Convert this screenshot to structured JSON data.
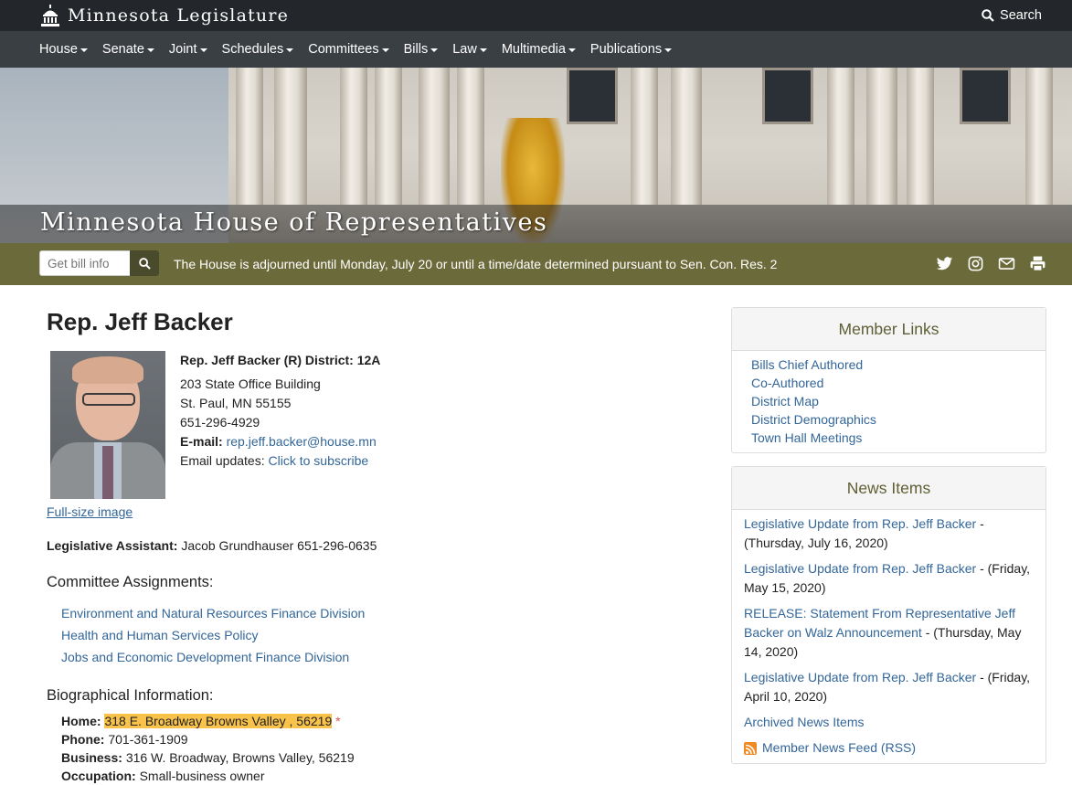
{
  "header": {
    "site_title": "Minnesota Legislature",
    "search_label": "Search"
  },
  "nav": {
    "items": [
      "House",
      "Senate",
      "Joint",
      "Schedules",
      "Committees",
      "Bills",
      "Law",
      "Multimedia",
      "Publications"
    ]
  },
  "hero": {
    "title": "Minnesota House of Representatives"
  },
  "olive_bar": {
    "bill_placeholder": "Get bill info",
    "notice": "The House is adjourned until Monday, July 20 or until a time/date determined pursuant to Sen. Con. Res. 2",
    "social_icons": [
      "twitter-icon",
      "instagram-icon",
      "email-icon",
      "print-icon"
    ]
  },
  "member": {
    "title": "Rep. Jeff Backer",
    "heading_line": "Rep. Jeff Backer (R) District: 12A",
    "address1": "203 State Office Building",
    "address2": "St. Paul, MN 55155",
    "phone": "651-296-4929",
    "email_label": "E-mail:",
    "email": "rep.jeff.backer@house.mn",
    "updates_label": "Email updates:",
    "updates_link": "Click to subscribe",
    "fullsize_link": "Full-size image",
    "assistant_label": "Legislative Assistant:",
    "assistant_value": "Jacob Grundhauser 651-296-0635"
  },
  "committees": {
    "heading": "Committee Assignments:",
    "items": [
      "Environment and Natural Resources Finance Division",
      "Health and Human Services Policy",
      "Jobs and Economic Development Finance Division"
    ]
  },
  "bio": {
    "heading": "Biographical Information:",
    "home_label": "Home:",
    "home_value": "318 E. Broadway Browns Valley , 56219",
    "home_marker": "*",
    "phone_label": "Phone:",
    "phone_value": "701-361-1909",
    "business_label": "Business:",
    "business_value": "316 W. Broadway, Browns Valley, 56219",
    "occupation_label": "Occupation:",
    "occupation_value": "Small-business owner"
  },
  "member_links": {
    "heading": "Member Links",
    "items": [
      "Bills Chief Authored",
      "Co-Authored",
      "District Map",
      "District Demographics",
      "Town Hall Meetings"
    ]
  },
  "news": {
    "heading": "News Items",
    "items": [
      {
        "link": "Legislative Update from Rep. Jeff Backer",
        "date": " - (Thursday, July 16, 2020)"
      },
      {
        "link": "Legislative Update from Rep. Jeff Backer",
        "date": " - (Friday, May 15, 2020)"
      },
      {
        "link": "RELEASE: Statement From Representative Jeff Backer on Walz Announcement",
        "date": " - (Thursday, May 14, 2020)"
      },
      {
        "link": "Legislative Update from Rep. Jeff Backer",
        "date": " - (Friday, April 10, 2020)"
      }
    ],
    "archived": "Archived News Items",
    "rss": "Member News Feed (RSS)"
  },
  "colors": {
    "topbar": "#23272b",
    "navbar": "#3a3f44",
    "olive": "#6b6a3a",
    "link": "#336699",
    "highlight": "#f9c24a"
  }
}
